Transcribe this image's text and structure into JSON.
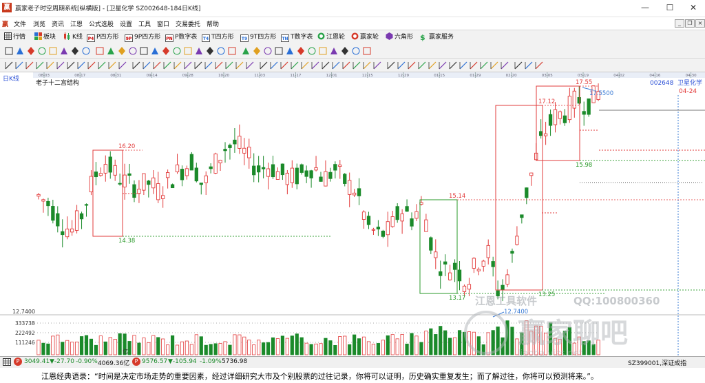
{
  "window": {
    "logo_text": "赢",
    "title": "赢家老子时空周期系统[纵横版] - [卫星化学  SZ002648-184日K线]",
    "controls": [
      "—",
      "☐",
      "✕"
    ]
  },
  "menu": {
    "items": [
      "文件",
      "浏览",
      "资讯",
      "江恩",
      "公式选股",
      "设置",
      "工具",
      "窗口",
      "交易委托",
      "帮助"
    ],
    "mdi": [
      "_",
      "❐",
      "×"
    ]
  },
  "toolbar": {
    "items": [
      {
        "icon": "grid-icon",
        "label": "行情"
      },
      {
        "icon": "blocks-icon",
        "label": "板块"
      },
      {
        "icon": "kline-icon",
        "label": "K线"
      },
      {
        "icon": "p-square-icon",
        "badge": "P4",
        "label": "P四方形"
      },
      {
        "icon": "p-square-icon",
        "badge": "9P",
        "label": "9P四方形"
      },
      {
        "icon": "p-number-icon",
        "badge": "PN",
        "label": "P数字表"
      },
      {
        "icon": "t-square-icon",
        "badge": "T4",
        "label": "T四方形"
      },
      {
        "icon": "t-square-icon",
        "badge": "T9",
        "label": "9T四方形"
      },
      {
        "icon": "t-number-icon",
        "badge": "TN",
        "label": "T数字表"
      },
      {
        "icon": "wheel-icon",
        "label": "江恩轮"
      },
      {
        "icon": "wheel-icon",
        "label": "赢家轮"
      },
      {
        "icon": "hexagon-icon",
        "label": "六角形"
      },
      {
        "icon": "dollar-icon",
        "label": "赢家服务"
      }
    ]
  },
  "chart": {
    "period_label": "日K线",
    "indicator_title": "老子十二宫结构",
    "stock_code": "002648",
    "stock_name": "卫星化学",
    "date_ticks": [
      "08-03",
      "08-17",
      "08-31",
      "09-14",
      "09-28",
      "10-20",
      "11-03",
      "11-17",
      "12-01",
      "12-15",
      "12-29",
      "01-15",
      "01-29",
      "02-20",
      "03-05",
      "03-19",
      "04-02",
      "04-16",
      "04-30"
    ],
    "cursor_date": "04-24",
    "cursor_price": "17.5500",
    "low_price_label": "12.7400",
    "axis_low": "12.7400",
    "volume_ticks": [
      "333738",
      "222492",
      "111246"
    ],
    "volume_unit": "亿",
    "box_labels": [
      {
        "text": "16.20",
        "kind": "high"
      },
      {
        "text": "14.38",
        "kind": "low"
      },
      {
        "text": "15.14",
        "kind": "high"
      },
      {
        "text": "13.17",
        "kind": "low"
      },
      {
        "text": "17.12",
        "kind": "high"
      },
      {
        "text": "13.25",
        "kind": "low"
      },
      {
        "text": "17.55",
        "kind": "high"
      },
      {
        "text": "15.98",
        "kind": "low"
      }
    ],
    "watermark_software": "江恩工具软件",
    "watermark_qq": "QQ:100800360",
    "watermark_site": "赢家聊吧",
    "watermark_url": "liaoba.yjzs.net"
  },
  "chart_data": {
    "type": "candlestick",
    "title": "老子十二宫结构",
    "xlabel": "",
    "ylabel": "",
    "series": [
      {
        "name": "卫星化学",
        "close": [
          15.2,
          15.0,
          14.6,
          14.4,
          14.8,
          15.6,
          16.0,
          15.7,
          15.5,
          15.4,
          15.5,
          15.3,
          15.6,
          15.8,
          16.0,
          15.4,
          15.9,
          16.3,
          16.4,
          16.1,
          15.8,
          15.9,
          15.7,
          15.6,
          15.7,
          15.9,
          15.6,
          15.8,
          15.5,
          15.3,
          14.5,
          14.3,
          14.4,
          14.9,
          14.7,
          15.0,
          13.9,
          13.5,
          13.6,
          13.2,
          13.7,
          13.9,
          12.9,
          13.6,
          14.8,
          15.8,
          16.6,
          17.0,
          17.1,
          17.4,
          17.3,
          17.55
        ]
      }
    ],
    "volume_ticks": [
      333738,
      222492,
      111246
    ],
    "ylim": [
      12.74,
      17.55
    ]
  },
  "status": {
    "index1_value": "3049.41",
    "index1_change": "▼-27.70",
    "index1_pct": "-0.90%",
    "index1_amount": "4069.36亿",
    "index2_value": "9576.57",
    "index2_change": "▼-105.94",
    "index2_pct": "-1.09%",
    "index2_amount": "5736.98",
    "right_text": "SZ399001,深证成指"
  },
  "quote": {
    "text": "江恩经典语录：“时间是决定市场走势的重要因素，经过详细研究大市及个别股票的过往记录，你将可以证明，历史确实重复发生；而了解过往，你将可以预测将来。”。"
  },
  "colors": {
    "up": "#e23b3b",
    "down": "#1b8a2a",
    "box": "#e23b3b",
    "box_green": "#2a9a2a",
    "cursor": "#3a7bd5"
  }
}
